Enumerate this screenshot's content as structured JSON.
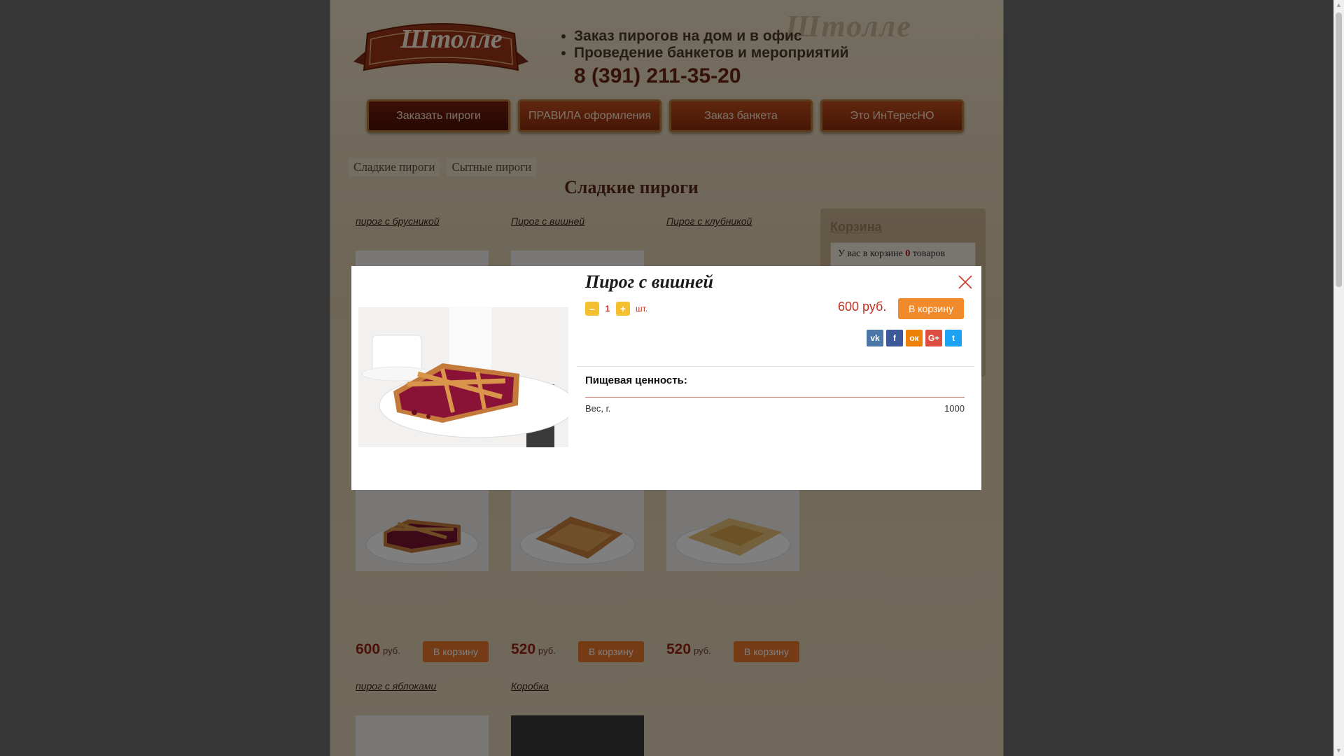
{
  "header": {
    "logo_text": "Штолле",
    "watermark_text": "Штолле",
    "line1": "Заказ пирогов на дом и в офис",
    "line2": "Проведение банкетов и мероприятий",
    "phone": "8 (391) 211-35-20"
  },
  "nav": {
    "items": [
      {
        "label": "Заказать пироги"
      },
      {
        "label": "ПРАВИЛА оформления"
      },
      {
        "label": "Заказ банкета"
      },
      {
        "label": "Это ИнТересНО"
      }
    ]
  },
  "categories": {
    "tabs": [
      {
        "label": "Сладкие пироги"
      },
      {
        "label": "Сытные пироги"
      }
    ],
    "title": "Сладкие пироги"
  },
  "products": [
    {
      "name": "пирог с брусникой"
    },
    {
      "name": "Пирог с вишней"
    },
    {
      "name": "Пирог с клубникой"
    },
    {
      "name": "",
      "price": "600",
      "currency": "руб.",
      "buy_label": "В корзину"
    },
    {
      "name": "",
      "price": "520",
      "currency": "руб.",
      "buy_label": "В корзину"
    },
    {
      "name": "",
      "price": "520",
      "currency": "руб.",
      "buy_label": "В корзину"
    },
    {
      "name": "пирог с яблоками"
    },
    {
      "name": "Коробка"
    }
  ],
  "cart": {
    "title": "Корзина",
    "text_before": "У вас в корзине",
    "count": "0",
    "text_after": "товаров"
  },
  "modal": {
    "title": "Пирог с вишней",
    "quantity": "1",
    "qty_minus": "–",
    "qty_plus": "+",
    "unit": "шт.",
    "price": "600 руб.",
    "buy_label": "В корзину",
    "share": [
      {
        "icon": "vk-icon",
        "glyph": "vk",
        "color": "#4a76a8"
      },
      {
        "icon": "facebook-icon",
        "glyph": "f",
        "color": "#3b5998"
      },
      {
        "icon": "odnoklassniki-icon",
        "glyph": "ок",
        "color": "#ee8208"
      },
      {
        "icon": "google-plus-icon",
        "glyph": "G+",
        "color": "#dc4e41"
      },
      {
        "icon": "twitter-icon",
        "glyph": "t",
        "color": "#1da1f2"
      }
    ],
    "nutrition_title": "Пищевая ценность:",
    "nutrition": [
      {
        "label": "Вес, г.",
        "value": "1000"
      }
    ]
  }
}
